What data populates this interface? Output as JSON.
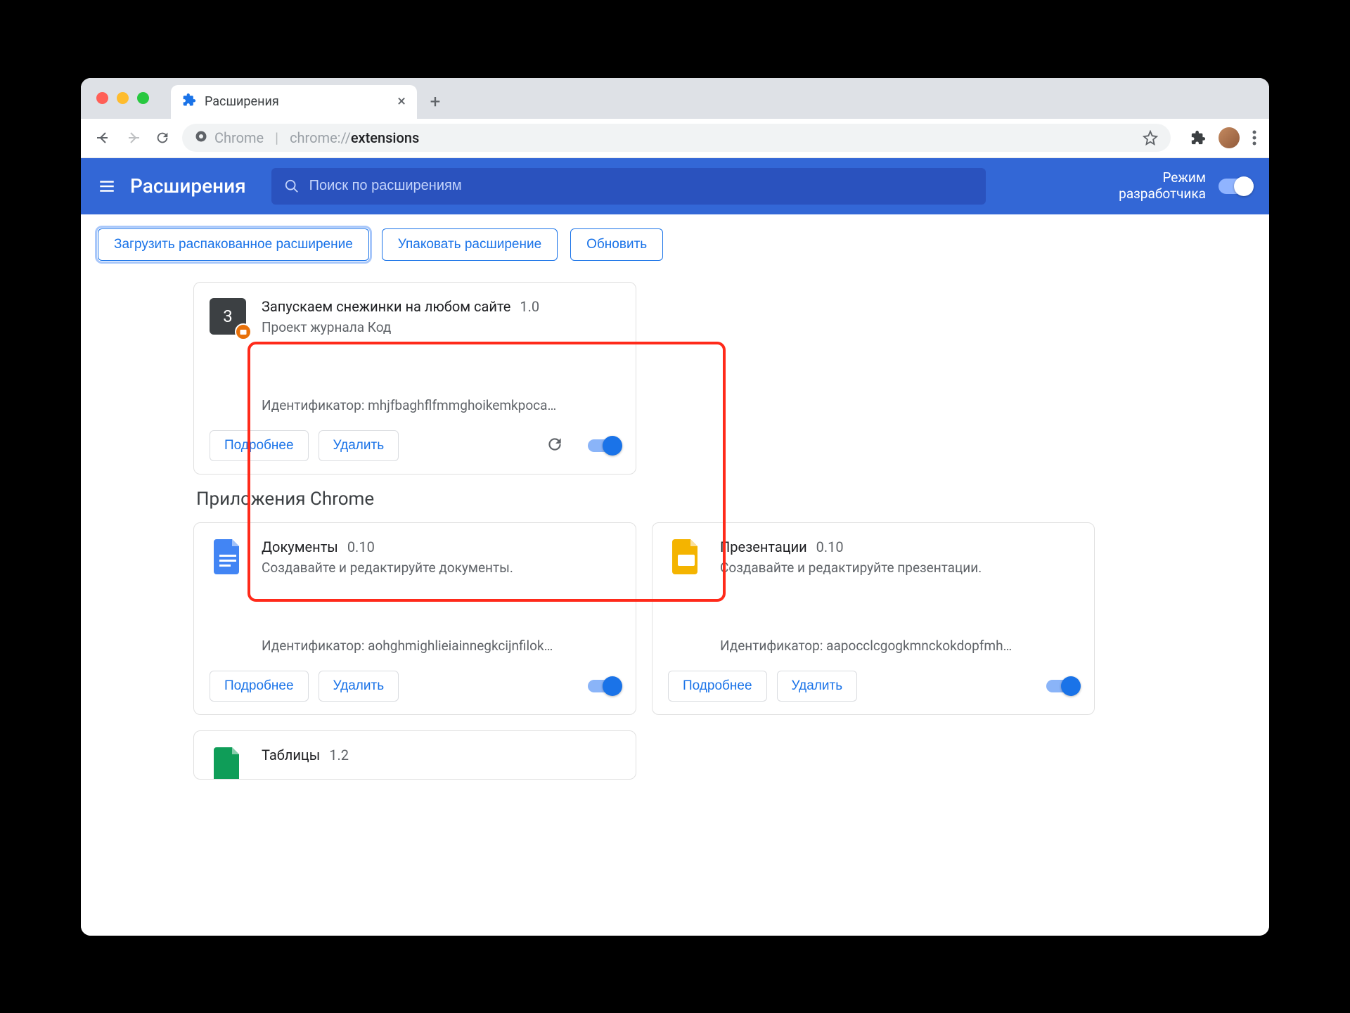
{
  "tab": {
    "title": "Расширения"
  },
  "omnibox": {
    "scheme_label": "Chrome",
    "url_dim": "chrome://",
    "url_bold": "extensions"
  },
  "header": {
    "title": "Расширения",
    "search_placeholder": "Поиск по расширениям",
    "dev_mode_line1": "Режим",
    "dev_mode_line2": "разработчика"
  },
  "actions": {
    "load_unpacked": "Загрузить распакованное расширение",
    "pack": "Упаковать расширение",
    "update": "Обновить"
  },
  "labels": {
    "details": "Подробнее",
    "remove": "Удалить",
    "id_prefix": "Идентификатор:"
  },
  "extension": {
    "name": "Запускаем снежинки на любом сайте",
    "version": "1.0",
    "description": "Проект журнала Код",
    "id": "mhjfbaghflfmmghoikemkpoca…",
    "icon_text": "3"
  },
  "apps_section_title": "Приложения Chrome",
  "apps": [
    {
      "name": "Документы",
      "version": "0.10",
      "description": "Создавайте и редактируйте документы.",
      "id": "aohghmighlieiainnegkcijnfilok…",
      "color": "#4285f4"
    },
    {
      "name": "Презентации",
      "version": "0.10",
      "description": "Создавайте и редактируйте презентации.",
      "id": "aapocclcgogkmnckokdopfmh…",
      "color": "#f4b400"
    },
    {
      "name": "Таблицы",
      "version": "1.2",
      "color": "#0f9d58"
    }
  ]
}
